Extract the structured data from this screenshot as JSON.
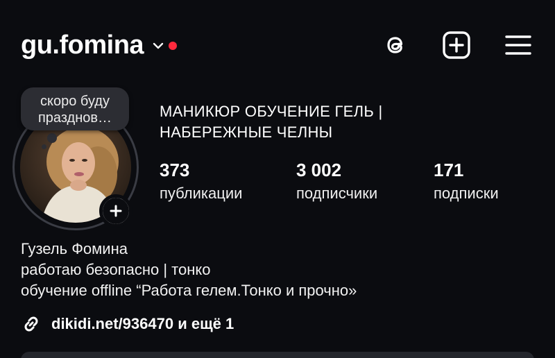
{
  "header": {
    "username": "gu.fomina",
    "icons": {
      "threads": "threads-icon",
      "create": "plus-square-icon",
      "menu": "hamburger-menu-icon"
    },
    "notification_color": "#ff2a3d"
  },
  "avatar": {
    "note": "скоро буду празднов…",
    "add_story_icon": "plus-icon"
  },
  "profile": {
    "category_line1": "МАНИКЮР ОБУЧЕНИЕ ГЕЛЬ |",
    "category_line2": "НАБЕРЕЖНЫЕ ЧЕЛНЫ"
  },
  "stats": [
    {
      "value": "373",
      "label": "публикации"
    },
    {
      "value": "3 002",
      "label": "подписчики"
    },
    {
      "value": "171",
      "label": "подписки"
    }
  ],
  "bio": {
    "name": "Гузель Фомина",
    "line1": "работаю безопасно | тонко",
    "line2": "обучение offline “Работа гелем.Тонко и прочно»",
    "link": "dikidi.net/936470 и ещё 1",
    "link_icon": "link-icon"
  }
}
